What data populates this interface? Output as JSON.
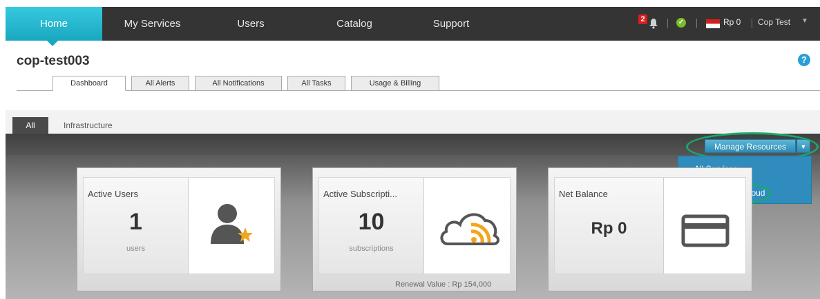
{
  "nav": {
    "tabs": [
      {
        "label": "Home"
      },
      {
        "label": "My Services"
      },
      {
        "label": "Users"
      },
      {
        "label": "Catalog"
      },
      {
        "label": "Support"
      }
    ],
    "notification_count": "2",
    "balance": "Rp 0",
    "user": "Cop Test"
  },
  "page": {
    "title": "cop-test003",
    "help": "?",
    "subtabs": [
      {
        "label": "Dashboard"
      },
      {
        "label": "All Alerts"
      },
      {
        "label": "All Notifications"
      },
      {
        "label": "All Tasks"
      },
      {
        "label": "Usage & Billing"
      }
    ]
  },
  "filter": {
    "tabs": [
      {
        "label": "All"
      },
      {
        "label": "Infrastructure"
      }
    ]
  },
  "manage": {
    "label": "Manage Resources",
    "items": [
      {
        "label": "All Services"
      },
      {
        "label": "BIZNET GIO Cloud"
      }
    ]
  },
  "cards": {
    "users": {
      "title": "Active Users",
      "value": "1",
      "unit": "users"
    },
    "subs": {
      "title": "Active Subscripti...",
      "value": "10",
      "unit": "subscriptions",
      "footer": "Renewal Value : Rp 154,000"
    },
    "balance": {
      "title": "Net Balance",
      "value": "Rp 0"
    }
  },
  "colors": {
    "accent": "#1aa7c0",
    "highlight": "#1aa86b",
    "button": "#2c8ab3"
  },
  "icons": [
    "bell-icon",
    "check-icon",
    "flag-icon",
    "help-icon",
    "user-icon",
    "cloud-rss-icon",
    "wallet-icon",
    "caret-down-icon"
  ]
}
